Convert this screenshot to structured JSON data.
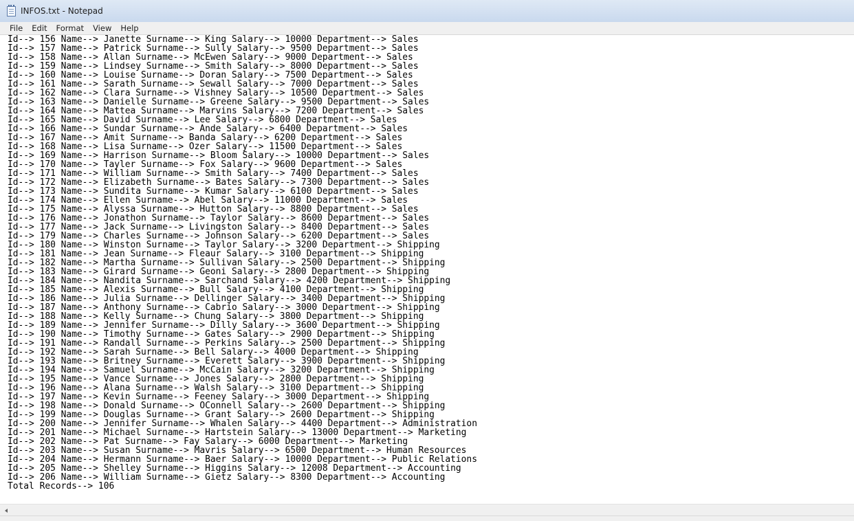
{
  "window": {
    "title": "INFOS.txt - Notepad"
  },
  "menu": {
    "file": "File",
    "edit": "Edit",
    "format": "Format",
    "view": "View",
    "help": "Help"
  },
  "editor": {
    "lines": [
      "Id--> 156 Name--> Janette Surname--> King Salary--> 10000 Department--> Sales",
      "Id--> 157 Name--> Patrick Surname--> Sully Salary--> 9500 Department--> Sales",
      "Id--> 158 Name--> Allan Surname--> McEwen Salary--> 9000 Department--> Sales",
      "Id--> 159 Name--> Lindsey Surname--> Smith Salary--> 8000 Department--> Sales",
      "Id--> 160 Name--> Louise Surname--> Doran Salary--> 7500 Department--> Sales",
      "Id--> 161 Name--> Sarath Surname--> Sewall Salary--> 7000 Department--> Sales",
      "Id--> 162 Name--> Clara Surname--> Vishney Salary--> 10500 Department--> Sales",
      "Id--> 163 Name--> Danielle Surname--> Greene Salary--> 9500 Department--> Sales",
      "Id--> 164 Name--> Mattea Surname--> Marvins Salary--> 7200 Department--> Sales",
      "Id--> 165 Name--> David Surname--> Lee Salary--> 6800 Department--> Sales",
      "Id--> 166 Name--> Sundar Surname--> Ande Salary--> 6400 Department--> Sales",
      "Id--> 167 Name--> Amit Surname--> Banda Salary--> 6200 Department--> Sales",
      "Id--> 168 Name--> Lisa Surname--> Ozer Salary--> 11500 Department--> Sales",
      "Id--> 169 Name--> Harrison Surname--> Bloom Salary--> 10000 Department--> Sales",
      "Id--> 170 Name--> Tayler Surname--> Fox Salary--> 9600 Department--> Sales",
      "Id--> 171 Name--> William Surname--> Smith Salary--> 7400 Department--> Sales",
      "Id--> 172 Name--> Elizabeth Surname--> Bates Salary--> 7300 Department--> Sales",
      "Id--> 173 Name--> Sundita Surname--> Kumar Salary--> 6100 Department--> Sales",
      "Id--> 174 Name--> Ellen Surname--> Abel Salary--> 11000 Department--> Sales",
      "Id--> 175 Name--> Alyssa Surname--> Hutton Salary--> 8800 Department--> Sales",
      "Id--> 176 Name--> Jonathon Surname--> Taylor Salary--> 8600 Department--> Sales",
      "Id--> 177 Name--> Jack Surname--> Livingston Salary--> 8400 Department--> Sales",
      "Id--> 179 Name--> Charles Surname--> Johnson Salary--> 6200 Department--> Sales",
      "Id--> 180 Name--> Winston Surname--> Taylor Salary--> 3200 Department--> Shipping",
      "Id--> 181 Name--> Jean Surname--> Fleaur Salary--> 3100 Department--> Shipping",
      "Id--> 182 Name--> Martha Surname--> Sullivan Salary--> 2500 Department--> Shipping",
      "Id--> 183 Name--> Girard Surname--> Geoni Salary--> 2800 Department--> Shipping",
      "Id--> 184 Name--> Nandita Surname--> Sarchand Salary--> 4200 Department--> Shipping",
      "Id--> 185 Name--> Alexis Surname--> Bull Salary--> 4100 Department--> Shipping",
      "Id--> 186 Name--> Julia Surname--> Dellinger Salary--> 3400 Department--> Shipping",
      "Id--> 187 Name--> Anthony Surname--> Cabrio Salary--> 3000 Department--> Shipping",
      "Id--> 188 Name--> Kelly Surname--> Chung Salary--> 3800 Department--> Shipping",
      "Id--> 189 Name--> Jennifer Surname--> Dilly Salary--> 3600 Department--> Shipping",
      "Id--> 190 Name--> Timothy Surname--> Gates Salary--> 2900 Department--> Shipping",
      "Id--> 191 Name--> Randall Surname--> Perkins Salary--> 2500 Department--> Shipping",
      "Id--> 192 Name--> Sarah Surname--> Bell Salary--> 4000 Department--> Shipping",
      "Id--> 193 Name--> Britney Surname--> Everett Salary--> 3900 Department--> Shipping",
      "Id--> 194 Name--> Samuel Surname--> McCain Salary--> 3200 Department--> Shipping",
      "Id--> 195 Name--> Vance Surname--> Jones Salary--> 2800 Department--> Shipping",
      "Id--> 196 Name--> Alana Surname--> Walsh Salary--> 3100 Department--> Shipping",
      "Id--> 197 Name--> Kevin Surname--> Feeney Salary--> 3000 Department--> Shipping",
      "Id--> 198 Name--> Donald Surname--> OConnell Salary--> 2600 Department--> Shipping",
      "Id--> 199 Name--> Douglas Surname--> Grant Salary--> 2600 Department--> Shipping",
      "Id--> 200 Name--> Jennifer Surname--> Whalen Salary--> 4400 Department--> Administration",
      "Id--> 201 Name--> Michael Surname--> Hartstein Salary--> 13000 Department--> Marketing",
      "Id--> 202 Name--> Pat Surname--> Fay Salary--> 6000 Department--> Marketing",
      "Id--> 203 Name--> Susan Surname--> Mavris Salary--> 6500 Department--> Human Resources",
      "Id--> 204 Name--> Hermann Surname--> Baer Salary--> 10000 Department--> Public Relations",
      "Id--> 205 Name--> Shelley Surname--> Higgins Salary--> 12008 Department--> Accounting",
      "Id--> 206 Name--> William Surname--> Gietz Salary--> 8300 Department--> Accounting",
      "Total Records--> 106"
    ]
  },
  "icons": {
    "app": "notepad-icon",
    "scroll_left": "scroll-left-arrow-icon"
  }
}
